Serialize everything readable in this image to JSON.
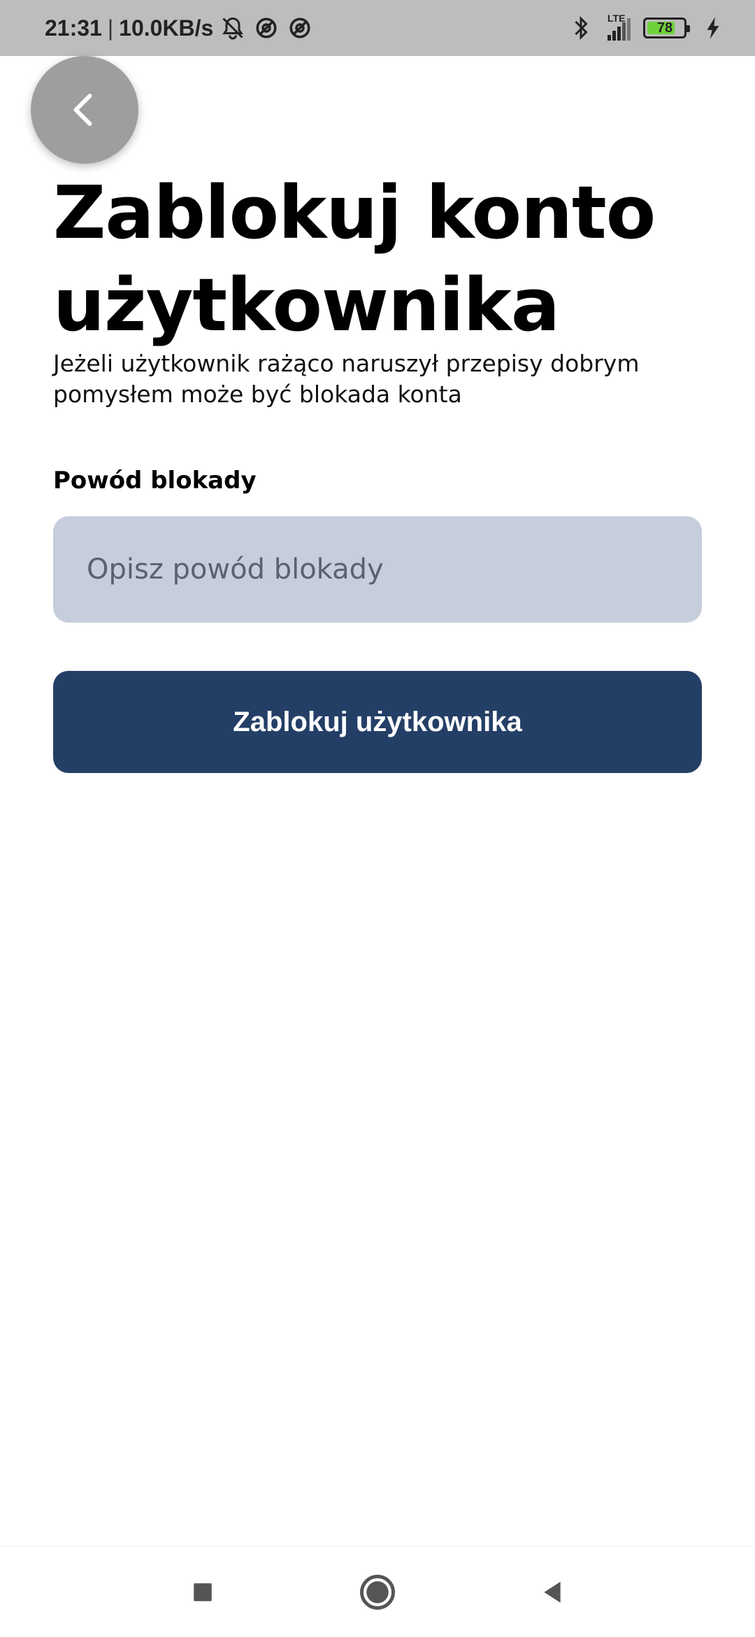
{
  "status_bar": {
    "time": "21:31",
    "separator": "|",
    "speed": "10.0KB/s",
    "network": "LTE",
    "battery_level": "78",
    "battery_color": "#6fd23a",
    "icons": [
      "mute-notifications-icon",
      "at-sign-icon",
      "at-sign-icon",
      "bluetooth-icon",
      "signal-icon",
      "battery-icon",
      "charging-icon"
    ]
  },
  "header": {
    "back_icon": "chevron-left-icon",
    "title": "Zablokuj konto użytkownika",
    "subtitle": "Jeżeli użytkownik rażąco naruszył przepisy dobrym pomysłem może być blokada konta"
  },
  "form": {
    "reason_label": "Powód blokady",
    "reason_placeholder": "Opisz powód blokady",
    "reason_value": "",
    "submit_label": "Zablokuj użytkownika"
  },
  "colors": {
    "primary": "#243f66",
    "input_bg": "#c6cedc",
    "back_button_bg": "#9e9e9e",
    "status_bar_bg": "#bdbdbd"
  },
  "nav_bar": {
    "icons": [
      "recent-apps-icon",
      "home-icon",
      "back-icon"
    ]
  }
}
